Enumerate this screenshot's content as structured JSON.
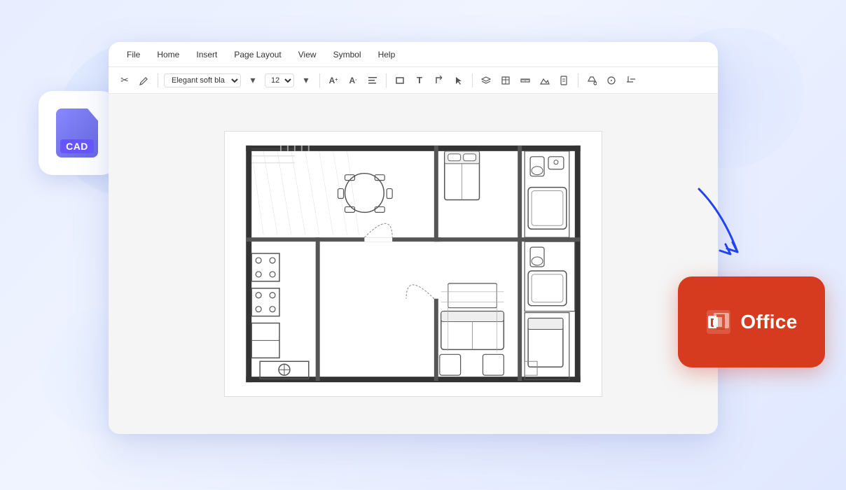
{
  "background": {
    "gradient_start": "#e8eeff",
    "gradient_end": "#e0e8ff"
  },
  "menu": {
    "items": [
      "File",
      "Home",
      "Insert",
      "Page Layout",
      "View",
      "Symbol",
      "Help"
    ]
  },
  "toolbar": {
    "font_name": "Elegant soft black",
    "font_size": "12",
    "icons": [
      "scissors",
      "pen",
      "font-increase",
      "font-decrease",
      "align",
      "rectangle",
      "text",
      "corner",
      "cursor",
      "layers",
      "table",
      "ruler",
      "mountain",
      "document",
      "paint",
      "circle",
      "crop"
    ]
  },
  "cad_icon": {
    "label": "CAD",
    "file_type": "CAD"
  },
  "office_icon": {
    "label": "Office",
    "brand": "Microsoft Office"
  },
  "floor_plan": {
    "description": "2D architectural floor plan showing rooms, furniture, kitchen, bathrooms, living room, and dining area"
  }
}
